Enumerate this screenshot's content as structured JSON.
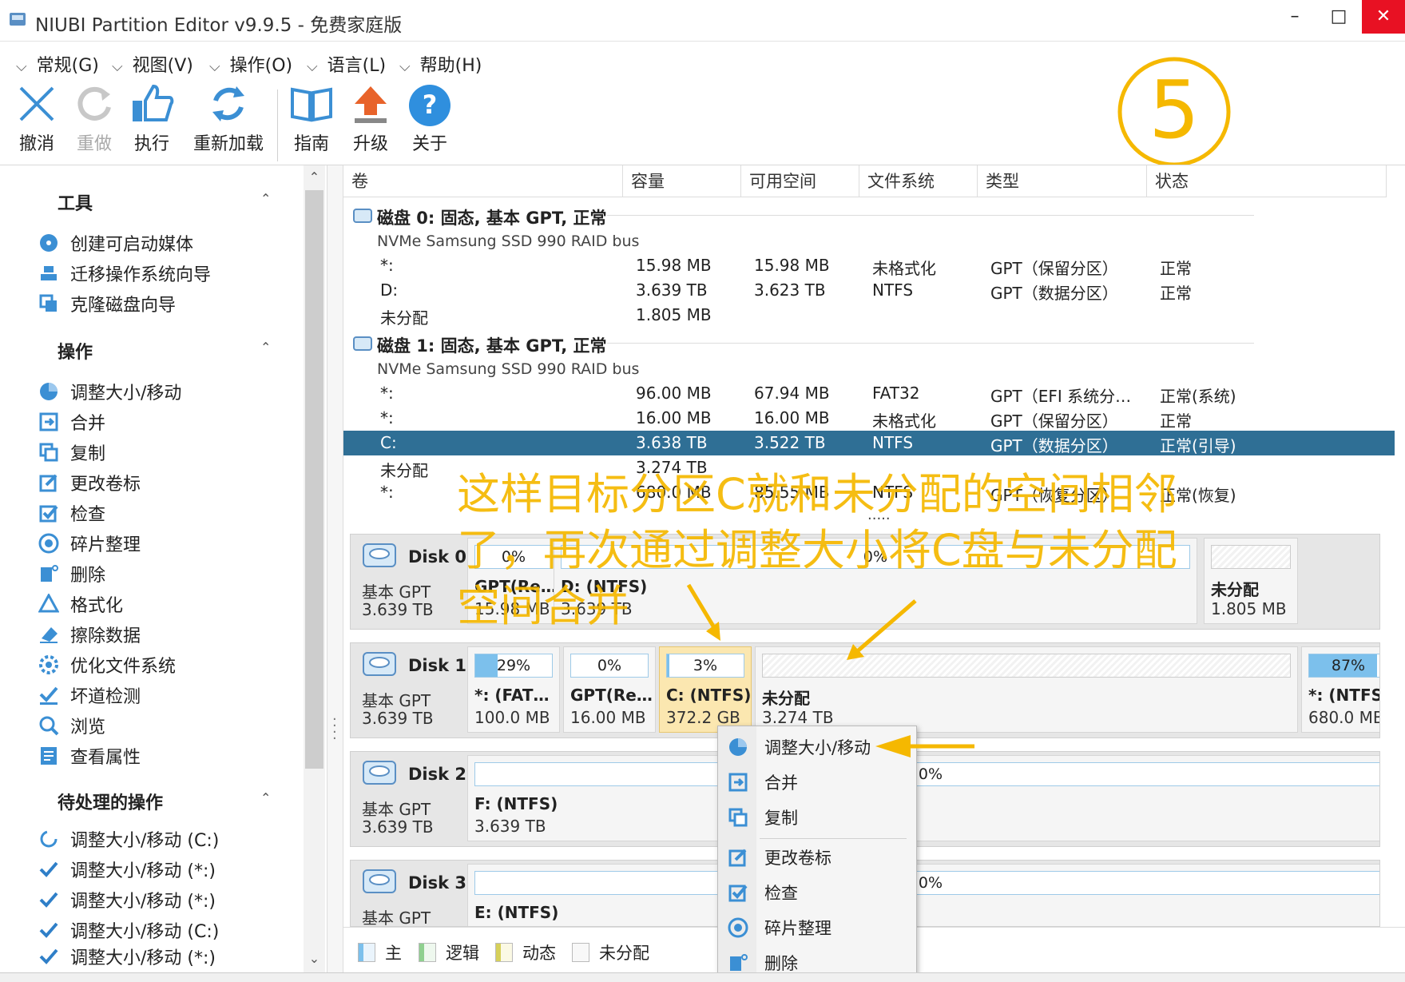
{
  "window": {
    "title": "NIUBI Partition Editor v9.9.5 - 免费家庭版",
    "minimize": "–",
    "maximize": "□",
    "close": "✕"
  },
  "menu": [
    "常规(G)",
    "视图(V)",
    "操作(O)",
    "语言(L)",
    "帮助(H)"
  ],
  "toolbar": [
    {
      "label": "撤消",
      "icon": "undo-icon"
    },
    {
      "label": "重做",
      "icon": "redo-icon"
    },
    {
      "label": "执行",
      "icon": "apply-icon"
    },
    {
      "label": "重新加载",
      "icon": "reload-icon"
    },
    {
      "label": "指南",
      "icon": "guide-book-icon"
    },
    {
      "label": "升级",
      "icon": "upgrade-icon"
    },
    {
      "label": "关于",
      "icon": "help-icon"
    }
  ],
  "sidebar": {
    "tools": {
      "title": "工具",
      "items": [
        "创建可启动媒体",
        "迁移操作系统向导",
        "克隆磁盘向导"
      ]
    },
    "operations": {
      "title": "操作",
      "items": [
        "调整大小/移动",
        "合并",
        "复制",
        "更改卷标",
        "检查",
        "碎片整理",
        "删除",
        "格式化",
        "擦除数据",
        "优化文件系统",
        "坏道检测",
        "浏览",
        "查看属性"
      ]
    },
    "pending": {
      "title": "待处理的操作",
      "items": [
        "调整大小/移动 (C:)",
        "调整大小/移动 (*:)",
        "调整大小/移动 (*:)",
        "调整大小/移动 (C:)",
        "调整大小/移动 (*:)"
      ]
    }
  },
  "table": {
    "columns": [
      "卷",
      "容量",
      "可用空间",
      "文件系统",
      "类型",
      "状态"
    ],
    "disks": [
      {
        "title": "磁盘 0: 固态, 基本 GPT, 正常",
        "subtitle": "NVMe Samsung SSD 990 RAID bus",
        "rows": [
          [
            "*:",
            "15.98 MB",
            "15.98 MB",
            "未格式化",
            "GPT（保留分区）",
            "正常"
          ],
          [
            "D:",
            "3.639 TB",
            "3.623 TB",
            "NTFS",
            "GPT（数据分区）",
            "正常"
          ],
          [
            "未分配",
            "1.805 MB",
            "",
            "",
            "",
            ""
          ]
        ]
      },
      {
        "title": "磁盘 1: 固态, 基本 GPT, 正常",
        "subtitle": "NVMe Samsung SSD 990 RAID bus",
        "rows": [
          [
            "*:",
            "96.00 MB",
            "67.94 MB",
            "FAT32",
            "GPT（EFI 系统分…",
            "正常(系统)"
          ],
          [
            "*:",
            "16.00 MB",
            "16.00 MB",
            "未格式化",
            "GPT（保留分区）",
            "正常"
          ],
          [
            "C:",
            "3.638 TB",
            "3.522 TB",
            "NTFS",
            "GPT（数据分区）",
            "正常(引导)"
          ],
          [
            "未分配",
            "3.274 TB",
            "",
            "",
            "",
            ""
          ],
          [
            "*:",
            "680.0 MB",
            "85.55 MB",
            "NTFS",
            "GPT（恢复分区）",
            "正常(恢复)"
          ]
        ]
      }
    ],
    "more": "....."
  },
  "diskmap": [
    {
      "name": "Disk 0",
      "type": "基本 GPT",
      "size": "3.639 TB",
      "parts": [
        {
          "pct": "0%",
          "fill": 0,
          "name": "GPT(Re…",
          "size": "15.98 MB"
        },
        {
          "pct": "0%",
          "fill": 0,
          "name": "D: (NTFS)",
          "size": "3.639 TB"
        },
        {
          "pct": "",
          "fill": 0,
          "name": "未分配",
          "size": "1.805 MB",
          "unalloc": true
        }
      ]
    },
    {
      "name": "Disk 1",
      "type": "基本 GPT",
      "size": "3.639 TB",
      "parts": [
        {
          "pct": "29%",
          "fill": 0.29,
          "name": "*: (FAT…",
          "size": "100.0 MB"
        },
        {
          "pct": "0%",
          "fill": 0,
          "name": "GPT(Re…",
          "size": "16.00 MB"
        },
        {
          "pct": "3%",
          "fill": 0.03,
          "name": "C: (NTFS)",
          "size": "372.2 GB",
          "selected": true
        },
        {
          "pct": "",
          "fill": 0,
          "name": "未分配",
          "size": "3.274 TB",
          "unalloc": true
        },
        {
          "pct": "87%",
          "fill": 0.87,
          "name": "*: (NTFS)",
          "size": "680.0 MB"
        }
      ]
    },
    {
      "name": "Disk 2",
      "type": "基本 GPT",
      "size": "3.639 TB",
      "parts": [
        {
          "pct": "0%",
          "fill": 0,
          "name": "F: (NTFS)",
          "size": "3.639 TB"
        }
      ]
    },
    {
      "name": "Disk 3",
      "type": "基本 GPT",
      "size": "",
      "parts": [
        {
          "pct": "0%",
          "fill": 0,
          "name": "E: (NTFS)",
          "size": ""
        }
      ]
    }
  ],
  "legend": [
    "主",
    "逻辑",
    "动态",
    "未分配"
  ],
  "context_menu": [
    "调整大小/移动",
    "合并",
    "复制",
    "更改卷标",
    "检查",
    "碎片整理",
    "删除"
  ],
  "annotations": {
    "step": "5",
    "line1": "这样目标分区C就和未分配的空间相邻",
    "line2": "了，再次通过调整大小将C盘与未分配",
    "line3": "空间合并"
  },
  "colors": {
    "accent": "#2f6f95",
    "annotation": "#f5b800",
    "usage_bar": "#7cc0ec",
    "selected_partition": "#fbe7b0",
    "close_button": "#e81123"
  }
}
